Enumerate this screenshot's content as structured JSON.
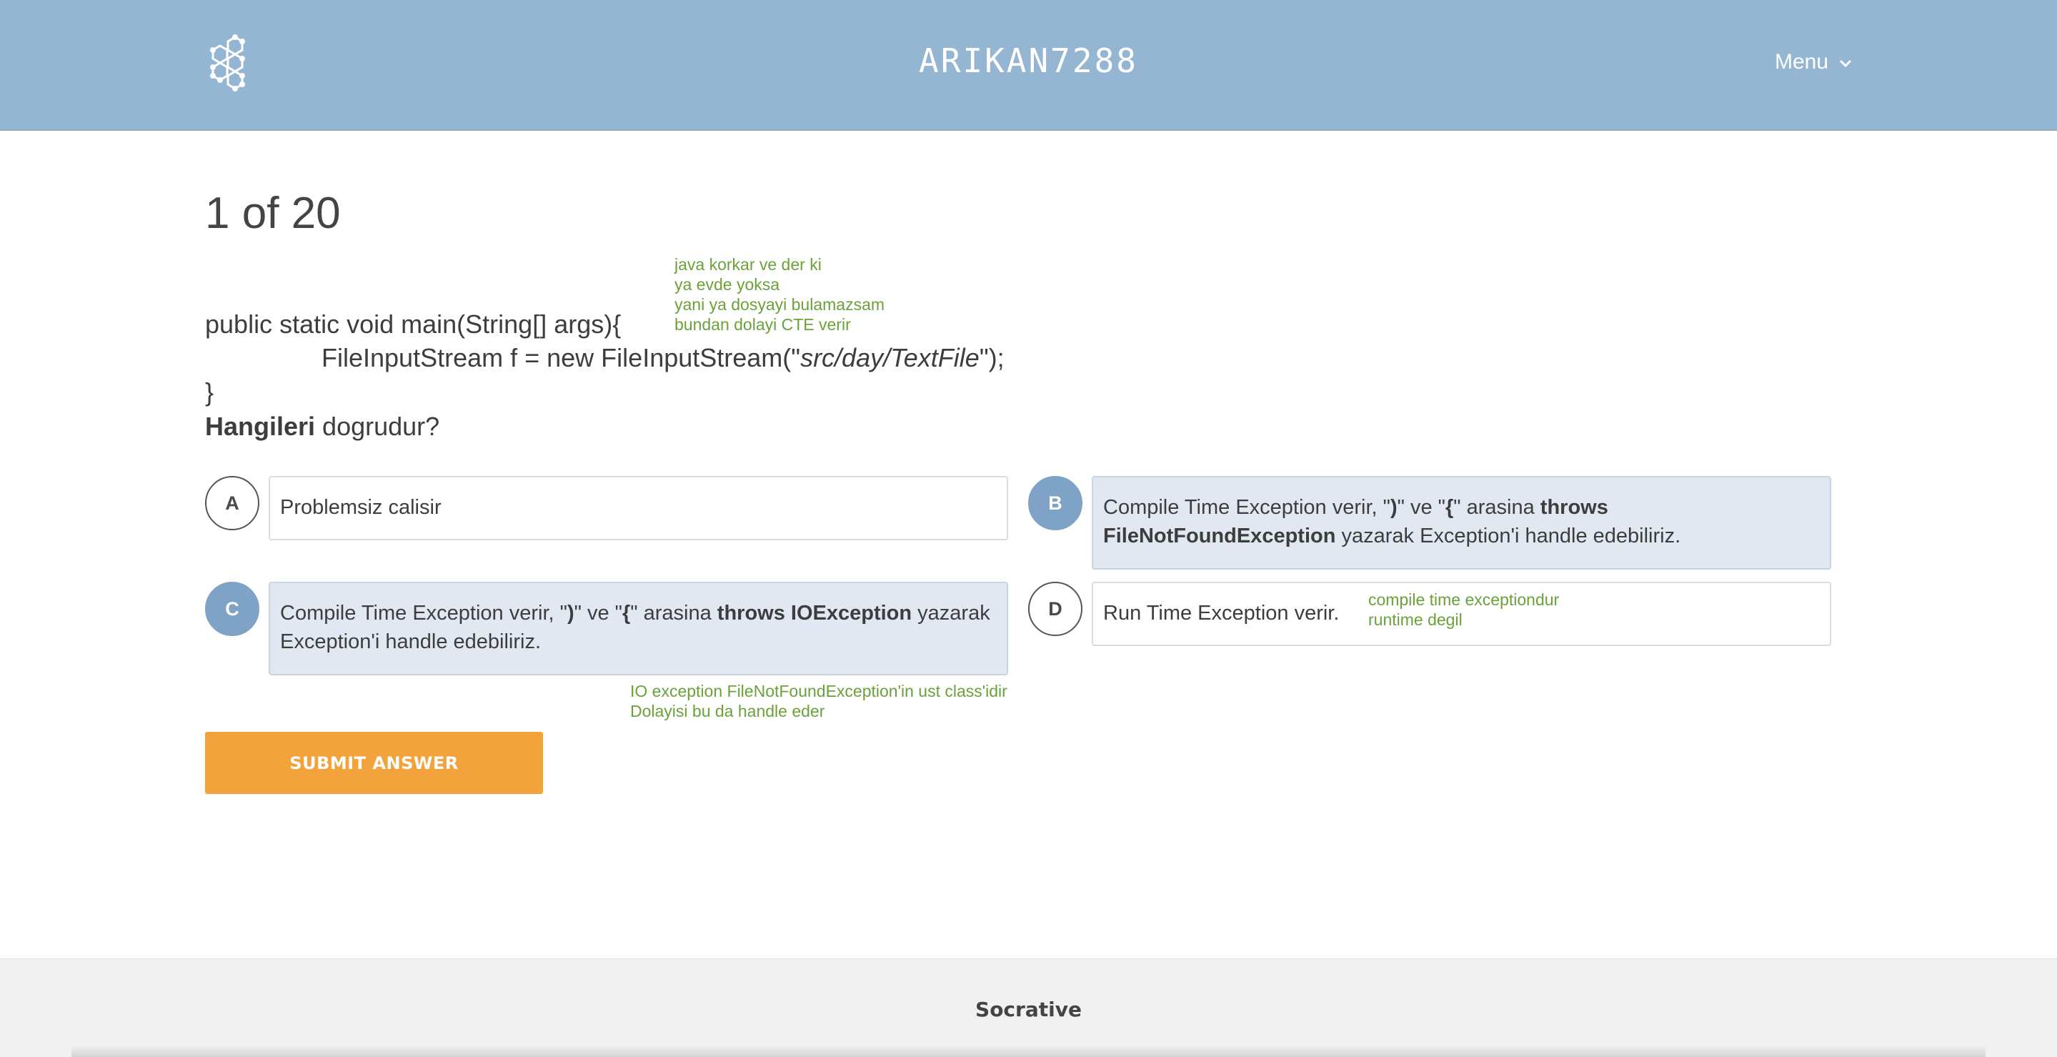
{
  "header": {
    "room_name": "ARIKAN7288",
    "menu_label": "Menu",
    "logo_icon": "hexagon-network-logo-icon",
    "menu_icon": "chevron-down-icon",
    "background_color": "#94b6d2"
  },
  "question": {
    "counter": "1 of 20",
    "code_line1": "public static void main(String[] args){",
    "code_line2_prefix": "FileInputStream f = new FileInputStream(\"",
    "code_line2_path": "src/day/TextFile",
    "code_line2_suffix": "\");",
    "code_line3": "}",
    "prompt_bold": "Hangileri",
    "prompt_rest": " dogrudur?",
    "note_top": [
      "java korkar ve der ki",
      "ya evde yoksa",
      "yani ya dosyayi bulamazsam",
      "bundan dolayi CTE verir"
    ]
  },
  "options": [
    {
      "letter": "A",
      "selected": false,
      "text": "Problemsiz calisir"
    },
    {
      "letter": "B",
      "selected": true,
      "parts": [
        "Compile Time Exception verir, \"",
        ")",
        "\" ve \"",
        "{",
        "\" arasina ",
        "throws FileNotFoundException",
        " yazarak Exception'i handle edebiliriz."
      ]
    },
    {
      "letter": "C",
      "selected": true,
      "parts": [
        "Compile Time Exception verir, \"",
        ")",
        "\" ve \"",
        "{",
        "\" arasina ",
        "throws IOException",
        " yazarak Exception'i handle edebiliriz."
      ],
      "note": [
        "IO exception FileNotFoundException'in ust class'idir",
        "Dolayisi bu da handle eder"
      ]
    },
    {
      "letter": "D",
      "selected": false,
      "text": "Run Time Exception verir.",
      "note": [
        "compile time exceptiondur",
        "runtime degil"
      ]
    }
  ],
  "submit_label": "SUBMIT ANSWER",
  "footer": {
    "brand": "Socrative"
  },
  "colors": {
    "selected_circle": "#7ea3c6",
    "selected_box": "#e1e8f1",
    "submit": "#f3a33b",
    "annotation": "#6aa23a"
  }
}
